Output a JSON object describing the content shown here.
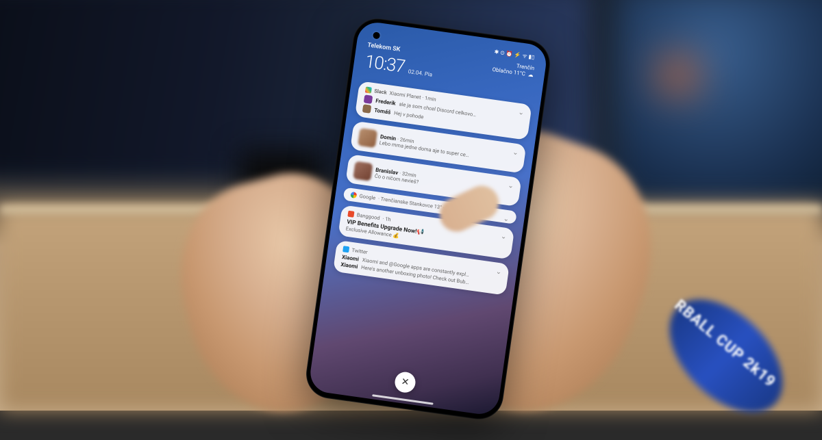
{
  "status": {
    "carrier": "Telekom SK",
    "icons": "✱ ⊙ ⏰ ⚡ ᯤ ▮▯"
  },
  "header": {
    "time": "10:37",
    "date": "02.04. Pia",
    "location": "Trenčín",
    "weather": "Oblačno 11°C"
  },
  "cards": {
    "slack": {
      "app": "Slack",
      "meta": "Xiaomi Planet · 1min",
      "m1_sender": "Frederik",
      "m1_text": "ale ja som chcel Discord celkovo…",
      "m2_sender": "Tomáš",
      "m2_text": "Hej v pohode"
    },
    "messenger1": {
      "sender": "Domin",
      "meta": "· 26min",
      "text": "Lebo mma jedne doma aje to super ce…"
    },
    "messenger2": {
      "sender": "Branislav",
      "meta": "· 32min",
      "text": "Čo o ničom nevieš?"
    },
    "google": {
      "app": "Google",
      "meta": "· Trenčianske Stankovce 13° · 24min"
    },
    "banggood": {
      "app": "Banggood",
      "meta": "· 1h",
      "title": "VIP Benefits Upgrade Now!📢",
      "sub": "Exclusive Allowance 💰"
    },
    "twitter": {
      "app": "Twitter",
      "l1_sender": "Xiaomi",
      "l1_text": "Xiaomi and @Google apps are constantly expl…",
      "l2_sender": "Xiaomi",
      "l2_text": "Here's another unboxing photo! Check out Bub…"
    }
  },
  "wristband": "RBALL CUP 2k19"
}
